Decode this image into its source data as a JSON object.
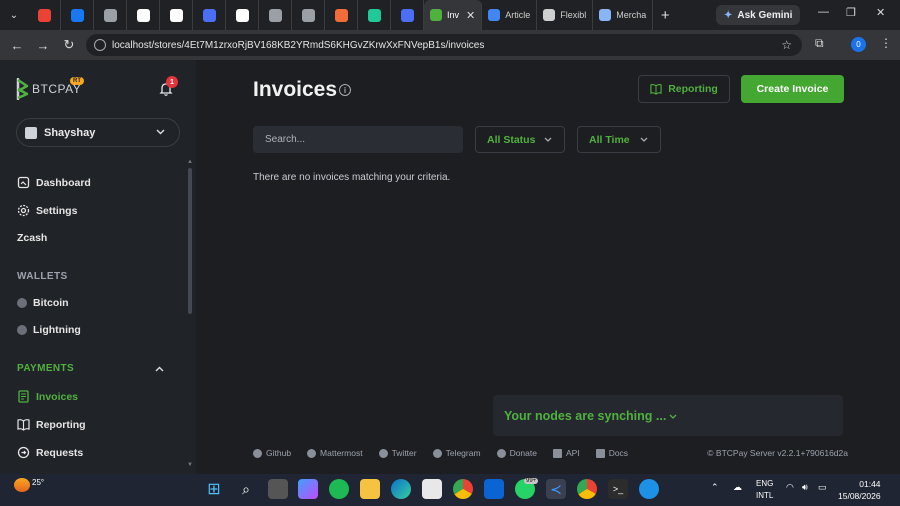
{
  "browser": {
    "tabs": [
      {
        "label": "",
        "icon": "gmail-icon",
        "color": "#ea4335"
      },
      {
        "label": "",
        "icon": "facebook-icon",
        "color": "#1877f2"
      },
      {
        "label": "",
        "icon": "globe-icon",
        "color": "#9aa0a6"
      },
      {
        "label": "",
        "icon": "wix-icon",
        "color": "#ffffff"
      },
      {
        "label": "",
        "icon": "wix-icon",
        "color": "#ffffff"
      },
      {
        "label": "",
        "icon": "site-icon",
        "color": "#4c6ef5"
      },
      {
        "label": "",
        "icon": "wix-icon",
        "color": "#ffffff"
      },
      {
        "label": "",
        "icon": "globe-icon",
        "color": "#9aa0a6"
      },
      {
        "label": "",
        "icon": "globe-icon",
        "color": "#9aa0a6"
      },
      {
        "label": "",
        "icon": "spark-icon",
        "color": "#f26c3a"
      },
      {
        "label": "",
        "icon": "terminal-icon",
        "color": "#20c997"
      },
      {
        "label": "",
        "icon": "site-icon",
        "color": "#4c6ef5"
      }
    ],
    "wide_tabs": [
      {
        "label": "Inv",
        "icon": "btcpay-icon",
        "color": "#51b13e",
        "active": true
      },
      {
        "label": "Article",
        "icon": "docs-icon",
        "color": "#4285f4",
        "active": false
      },
      {
        "label": "Flexibl",
        "icon": "site-icon",
        "color": "#cfcfcf",
        "active": false
      },
      {
        "label": "Mercha",
        "icon": "gemini-icon",
        "color": "#8ab4f8",
        "active": false
      }
    ],
    "new_tab": "+",
    "ask_gemini": "Ask Gemini",
    "url": "localhost/stores/4Et7M1zrxoRjBV168KB2YRmdS6KHGvZKrwXxFNVepB1s/invoices",
    "profile_initial": "0"
  },
  "sidebar": {
    "brand": "BTCPAY",
    "brand_badge": "RT",
    "notification_count": "1",
    "store_name": "Shayshay",
    "nav_top": [
      "Dashboard",
      "Settings",
      "Zcash"
    ],
    "wallets_label": "WALLETS",
    "wallets": [
      "Bitcoin",
      "Lightning"
    ],
    "payments_label": "PAYMENTS",
    "payments": [
      "Invoices",
      "Reporting",
      "Requests"
    ]
  },
  "main": {
    "title": "Invoices",
    "reporting_button": "Reporting",
    "create_button": "Create Invoice",
    "search_placeholder": "Search...",
    "status_filter": "All Status",
    "time_filter": "All Time",
    "empty_message": "There are no invoices matching your criteria.",
    "sync_message": "Your nodes are synching ...",
    "footer_links": [
      "Github",
      "Mattermost",
      "Twitter",
      "Telegram",
      "Donate",
      "API",
      "Docs"
    ],
    "version": "© BTCPay Server v2.2.1+790616d2a"
  },
  "taskbar": {
    "temperature": "25°",
    "badge": "99+",
    "lang": [
      "ENG",
      "INTL"
    ],
    "time": "01:44",
    "date": "15/08/2026"
  },
  "colors": {
    "accent": "#51b13e",
    "button": "#44a731",
    "sidebar": "#202328",
    "main_bg": "#1d1e22"
  }
}
